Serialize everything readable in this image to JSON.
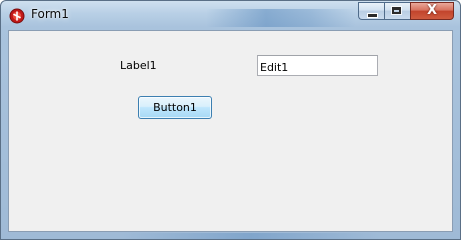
{
  "window": {
    "title": "Form1",
    "caption_buttons": {
      "minimize_icon": "minimize-icon",
      "maximize_icon": "maximize-icon",
      "close_label": "X"
    }
  },
  "form": {
    "label1": "Label1",
    "edit1_value": "Edit1",
    "button1_label": "Button1"
  },
  "colors": {
    "client_background": "#f0f0f0",
    "button_border": "#3c7fb1",
    "close_button": "#c2442c"
  }
}
